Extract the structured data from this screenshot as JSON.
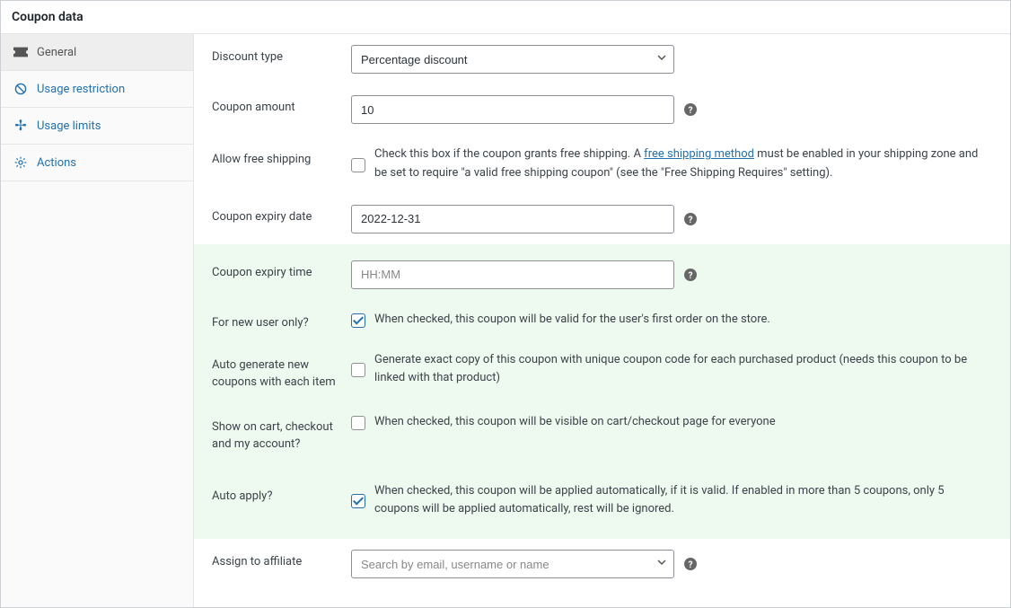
{
  "panel_title": "Coupon data",
  "tabs": {
    "general": "General",
    "usage_restriction": "Usage restriction",
    "usage_limits": "Usage limits",
    "actions": "Actions"
  },
  "fields": {
    "discount_type": {
      "label": "Discount type",
      "value": "Percentage discount"
    },
    "coupon_amount": {
      "label": "Coupon amount",
      "value": "10"
    },
    "free_shipping": {
      "label": "Allow free shipping",
      "desc_before": "Check this box if the coupon grants free shipping. A ",
      "link_text": "free shipping method",
      "desc_after": " must be enabled in your shipping zone and be set to require \"a valid free shipping coupon\" (see the \"Free Shipping Requires\" setting)."
    },
    "expiry_date": {
      "label": "Coupon expiry date",
      "value": "2022-12-31"
    },
    "expiry_time": {
      "label": "Coupon expiry time",
      "placeholder": "HH:MM"
    },
    "new_user": {
      "label": "For new user only?",
      "desc": "When checked, this coupon will be valid for the user's first order on the store."
    },
    "auto_generate": {
      "label": "Auto generate new coupons with each item",
      "desc": "Generate exact copy of this coupon with unique coupon code for each purchased product (needs this coupon to be linked with that product)"
    },
    "show_on_cart": {
      "label": "Show on cart, checkout and my account?",
      "desc": "When checked, this coupon will be visible on cart/checkout page for everyone"
    },
    "auto_apply": {
      "label": "Auto apply?",
      "desc": "When checked, this coupon will be applied automatically, if it is valid. If enabled in more than 5 coupons, only 5 coupons will be applied automatically, rest will be ignored."
    },
    "assign_affiliate": {
      "label": "Assign to affiliate",
      "placeholder": "Search by email, username or name"
    }
  }
}
